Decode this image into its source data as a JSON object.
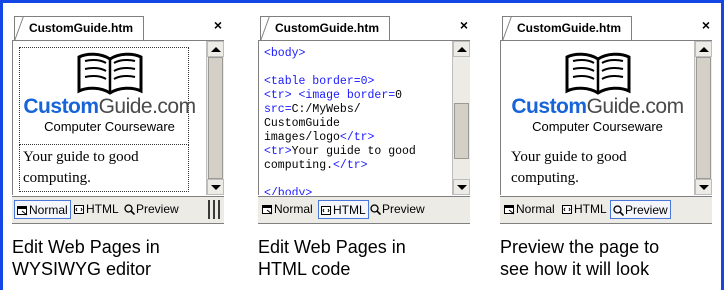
{
  "panels": [
    {
      "tab_title": "CustomGuide.htm",
      "close": "×",
      "views": {
        "normal": "Normal",
        "html": "HTML",
        "preview": "Preview"
      },
      "active_view": "normal",
      "logo": {
        "brand_a": "Custom",
        "brand_b": "Guide.com",
        "tagline": "Computer Courseware"
      },
      "text": [
        "Your guide to good",
        "computing."
      ],
      "caption": [
        "Edit Web Pages in",
        "WYSIWYG editor"
      ]
    },
    {
      "tab_title": "CustomGuide.htm",
      "close": "×",
      "views": {
        "normal": "Normal",
        "html": "HTML",
        "preview": "Preview"
      },
      "active_view": "html",
      "code": [
        [
          [
            "tag",
            "<body>"
          ]
        ],
        [],
        [
          [
            "tag",
            "<table border=0>"
          ]
        ],
        [
          [
            "tag",
            "<tr>"
          ],
          [
            "txt",
            " "
          ],
          [
            "tag",
            "<image border="
          ],
          [
            "txt",
            "0"
          ]
        ],
        [
          [
            "tag",
            "src="
          ],
          [
            "txt",
            "C:/MyWebs/"
          ]
        ],
        [
          [
            "txt",
            "CustomGuide"
          ]
        ],
        [
          [
            "txt",
            "images/logo"
          ],
          [
            "tag",
            "</tr>"
          ]
        ],
        [
          [
            "tag",
            "<tr>"
          ],
          [
            "txt",
            "Your guide to good"
          ]
        ],
        [
          [
            "txt",
            "computing."
          ],
          [
            "tag",
            "</tr>"
          ]
        ],
        [],
        [
          [
            "tag",
            "</body>"
          ]
        ]
      ],
      "caption": [
        "Edit Web Pages in",
        "HTML code"
      ]
    },
    {
      "tab_title": "CustomGuide.htm",
      "close": "×",
      "views": {
        "normal": "Normal",
        "html": "HTML",
        "preview": "Preview"
      },
      "active_view": "preview",
      "logo": {
        "brand_a": "Custom",
        "brand_b": "Guide.com",
        "tagline": "Computer Courseware"
      },
      "text": [
        "Your guide to good",
        "computing."
      ],
      "caption": [
        "Preview the page to",
        "see how it will look"
      ]
    }
  ],
  "colors": {
    "frame": "#1446e6",
    "code_tag": "#1a1aff",
    "brand_blue": "#1664d8"
  }
}
